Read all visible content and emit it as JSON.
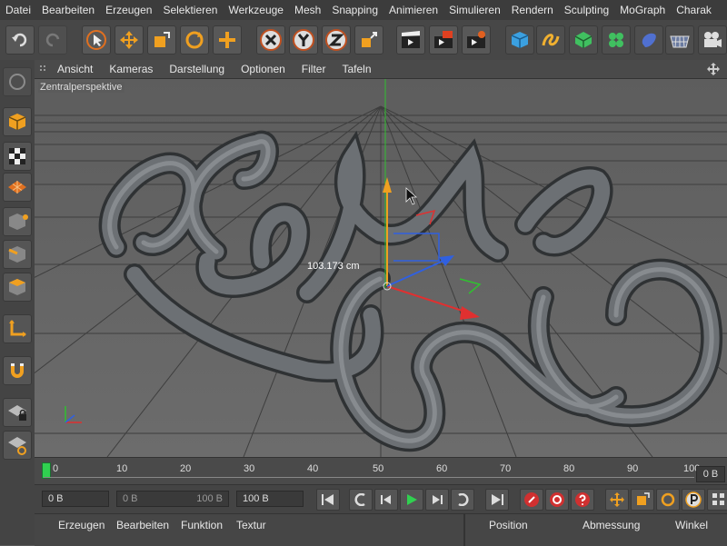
{
  "menubar": [
    "Datei",
    "Bearbeiten",
    "Erzeugen",
    "Selektieren",
    "Werkzeuge",
    "Mesh",
    "Snapping",
    "Animieren",
    "Simulieren",
    "Rendern",
    "Sculpting",
    "MoGraph",
    "Charak"
  ],
  "viewport_menu": [
    "Ansicht",
    "Kameras",
    "Darstellung",
    "Optionen",
    "Filter",
    "Tafeln"
  ],
  "viewport": {
    "label": "Zentralperspektive",
    "measurement": "103.173 cm"
  },
  "timeline": {
    "ticks": [
      "0",
      "10",
      "20",
      "30",
      "40",
      "50",
      "60",
      "70",
      "80",
      "90",
      "100"
    ],
    "current_frame": "0 B"
  },
  "transport": {
    "start": "0 B",
    "range_start": "0 B",
    "range_end": "100 B",
    "end": "100 B"
  },
  "bottom_left_tabs": [
    "Erzeugen",
    "Bearbeiten",
    "Funktion",
    "Textur"
  ],
  "bottom_right_tabs": [
    "Position",
    "Abmessung",
    "Winkel"
  ],
  "colors": {
    "accent": "#f0a020",
    "x_axis": "#e03030",
    "y_axis": "#30c030",
    "z_axis": "#3060e0"
  }
}
